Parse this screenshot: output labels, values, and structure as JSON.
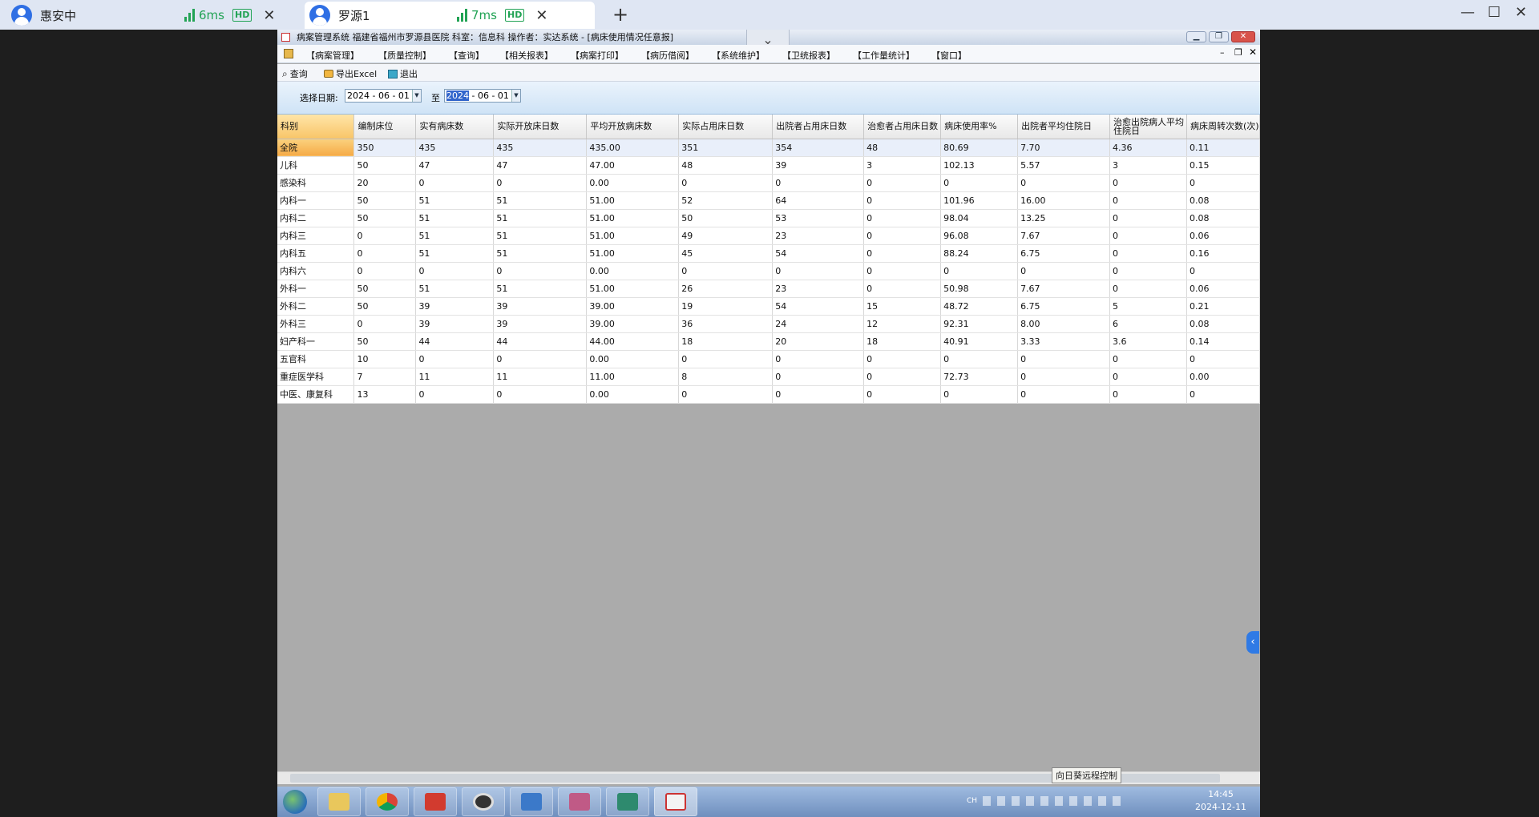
{
  "browser": {
    "tabs": [
      {
        "title": "惠安中",
        "ping": "6ms",
        "quality": "HD"
      },
      {
        "title": "罗源1",
        "ping": "7ms",
        "quality": "HD"
      }
    ],
    "new_tab": "+"
  },
  "app": {
    "title": "病案管理系统  福建省福州市罗源县医院  科室：信息科 操作者：实达系统 - [病床使用情况任意报]",
    "menu": [
      "【病案管理】",
      "【质量控制】",
      "【查询】",
      "【相关报表】",
      "【病案打印】",
      "【病历借阅】",
      "【系统维护】",
      "【卫统报表】",
      "【工作量统计】",
      "【窗口】"
    ],
    "toolbar": {
      "query": "查询",
      "export": "导出Excel",
      "exit": "退出"
    },
    "filter": {
      "label": "选择日期:",
      "to": "至",
      "start_date": "2024 - 06 - 01",
      "end_year": "2024",
      "end_rest": " - 06 - 01"
    },
    "grid": {
      "columns": [
        "科别",
        "编制床位",
        "实有病床数",
        "实际开放床日数",
        "平均开放病床数",
        "实际占用床日数",
        "出院者占用床日数",
        "治愈者占用床日数",
        "病床使用率%",
        "出院者平均住院日",
        "治愈出院病人平均住院日",
        "病床周转次数(次)"
      ],
      "rows": [
        [
          "全院",
          "350",
          "435",
          "435",
          "435.00",
          "351",
          "354",
          "48",
          "80.69",
          "7.70",
          "4.36",
          "0.11"
        ],
        [
          "儿科",
          "50",
          "47",
          "47",
          "47.00",
          "48",
          "39",
          "3",
          "102.13",
          "5.57",
          "3",
          "0.15"
        ],
        [
          "感染科",
          "20",
          "0",
          "0",
          "0.00",
          "0",
          "0",
          "0",
          "0",
          "0",
          "0",
          "0"
        ],
        [
          "内科一",
          "50",
          "51",
          "51",
          "51.00",
          "52",
          "64",
          "0",
          "101.96",
          "16.00",
          "0",
          "0.08"
        ],
        [
          "内科二",
          "50",
          "51",
          "51",
          "51.00",
          "50",
          "53",
          "0",
          "98.04",
          "13.25",
          "0",
          "0.08"
        ],
        [
          "内科三",
          "0",
          "51",
          "51",
          "51.00",
          "49",
          "23",
          "0",
          "96.08",
          "7.67",
          "0",
          "0.06"
        ],
        [
          "内科五",
          "0",
          "51",
          "51",
          "51.00",
          "45",
          "54",
          "0",
          "88.24",
          "6.75",
          "0",
          "0.16"
        ],
        [
          "内科六",
          "0",
          "0",
          "0",
          "0.00",
          "0",
          "0",
          "0",
          "0",
          "0",
          "0",
          "0"
        ],
        [
          "外科一",
          "50",
          "51",
          "51",
          "51.00",
          "26",
          "23",
          "0",
          "50.98",
          "7.67",
          "0",
          "0.06"
        ],
        [
          "外科二",
          "50",
          "39",
          "39",
          "39.00",
          "19",
          "54",
          "15",
          "48.72",
          "6.75",
          "5",
          "0.21"
        ],
        [
          "外科三",
          "0",
          "39",
          "39",
          "39.00",
          "36",
          "24",
          "12",
          "92.31",
          "8.00",
          "6",
          "0.08"
        ],
        [
          "妇产科一",
          "50",
          "44",
          "44",
          "44.00",
          "18",
          "20",
          "18",
          "40.91",
          "3.33",
          "3.6",
          "0.14"
        ],
        [
          "五官科",
          "10",
          "0",
          "0",
          "0.00",
          "0",
          "0",
          "0",
          "0",
          "0",
          "0",
          "0"
        ],
        [
          "重症医学科",
          "7",
          "11",
          "11",
          "11.00",
          "8",
          "0",
          "0",
          "72.73",
          "0",
          "0",
          "0.00"
        ],
        [
          "中医、康复科",
          "13",
          "0",
          "0",
          "0.00",
          "0",
          "0",
          "0",
          "0",
          "0",
          "0",
          "0"
        ]
      ]
    },
    "tooltip": "向日葵远程控制"
  },
  "taskbar": {
    "tray": "CH",
    "time": "14:45",
    "date": "2024-12-11"
  },
  "colors": {
    "accent": "#2f6fe4",
    "ping": "#22a355",
    "selected_row": "#f5aa47",
    "header_key": "#f8c568"
  }
}
